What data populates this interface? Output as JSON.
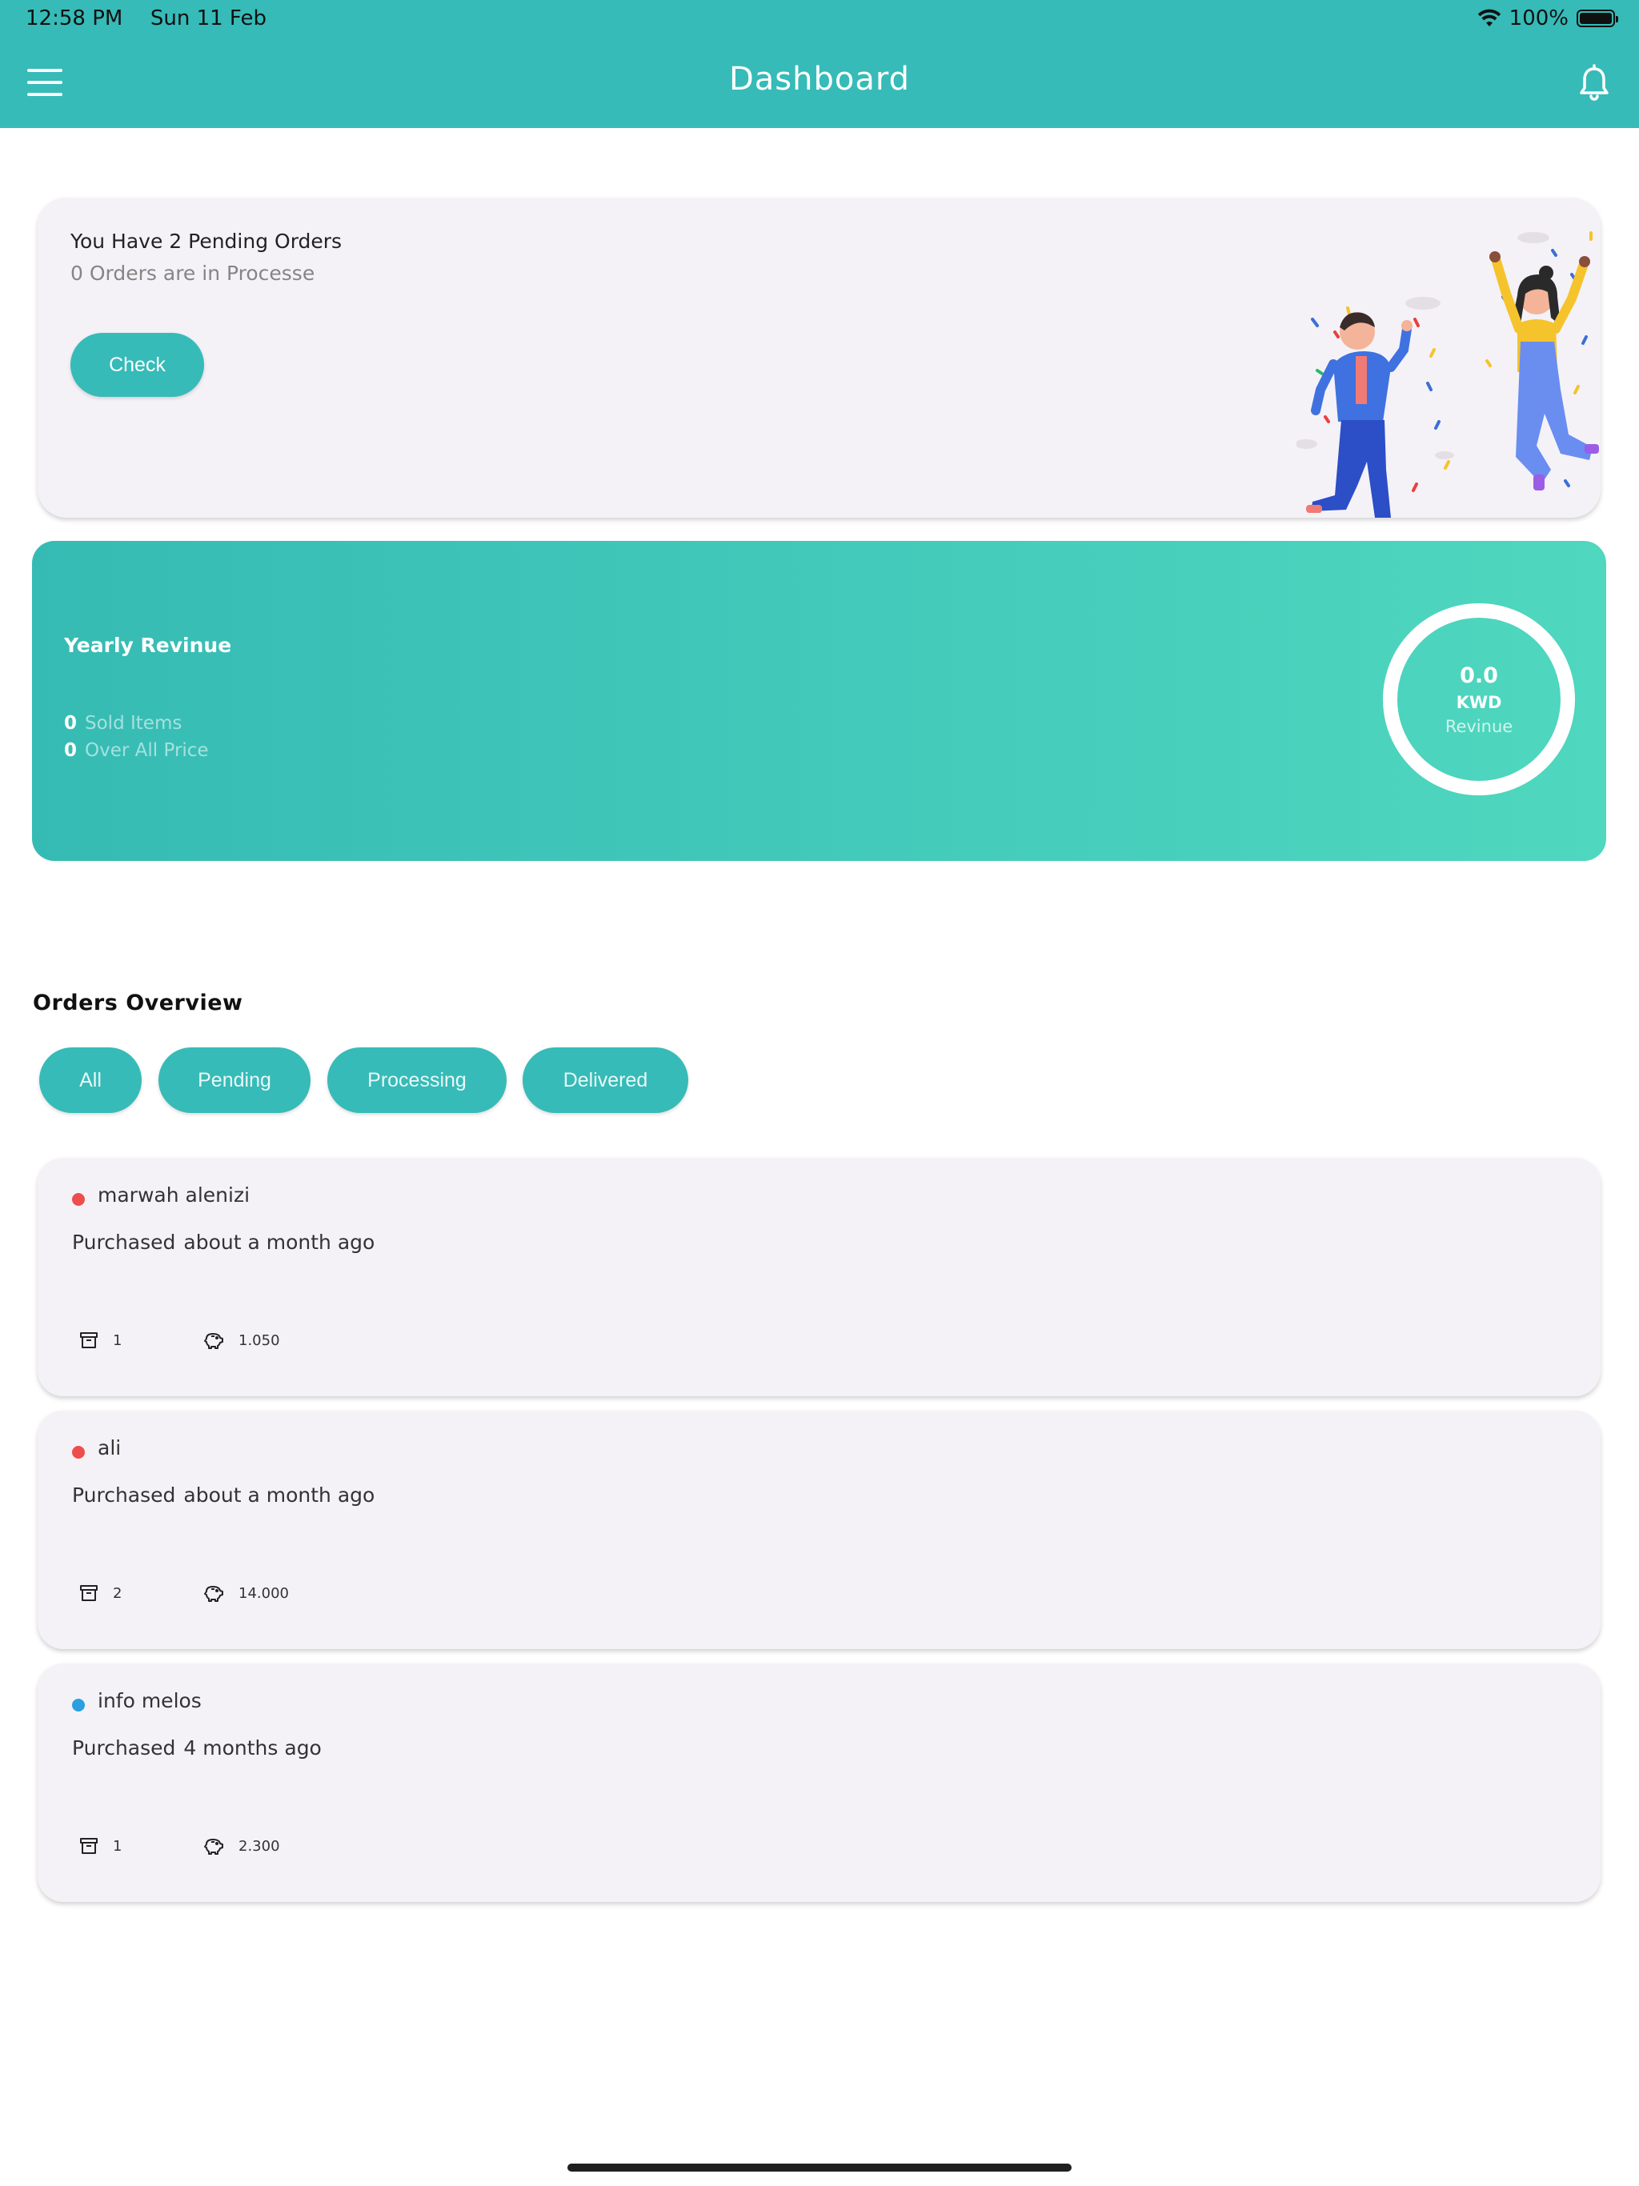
{
  "status_bar": {
    "time": "12:58 PM",
    "date": "Sun 11 Feb",
    "battery": "100%"
  },
  "header": {
    "title": "Dashboard"
  },
  "pending": {
    "title": "You Have 2 Pending Orders",
    "subtitle": "0 Orders are in Processe",
    "button_label": "Check"
  },
  "revenue": {
    "title": "Yearly Revinue",
    "sold_count": "0",
    "sold_label": "Sold Items",
    "price_count": "0",
    "price_label": "Over All Price",
    "ring_value": "0.0",
    "ring_currency": "KWD",
    "ring_label": "Revinue"
  },
  "orders_overview": {
    "title": "Orders Overview",
    "filters": [
      {
        "label": "All"
      },
      {
        "label": "Pending"
      },
      {
        "label": "Processing"
      },
      {
        "label": "Delivered"
      }
    ],
    "orders": [
      {
        "name": "marwah alenizi",
        "purchased_label": "Purchased",
        "time": "about a month ago",
        "items": "1",
        "price": "1.050",
        "status_color": "#ee4d4d"
      },
      {
        "name": "ali",
        "purchased_label": "Purchased",
        "time": "about a month ago",
        "items": "2",
        "price": "14.000",
        "status_color": "#ee4d4d"
      },
      {
        "name": "info melos",
        "purchased_label": "Purchased",
        "time": "4 months ago",
        "items": "1",
        "price": "2.300",
        "status_color": "#2b9fe0"
      }
    ]
  },
  "colors": {
    "accent": "#36bbb8",
    "card_bg": "#f4f2f7",
    "gradient_end": "#4fd7bf"
  },
  "icons": [
    "menu-icon",
    "bell-icon",
    "wifi-icon",
    "battery-icon",
    "archive-box-icon",
    "piggy-bank-icon"
  ]
}
